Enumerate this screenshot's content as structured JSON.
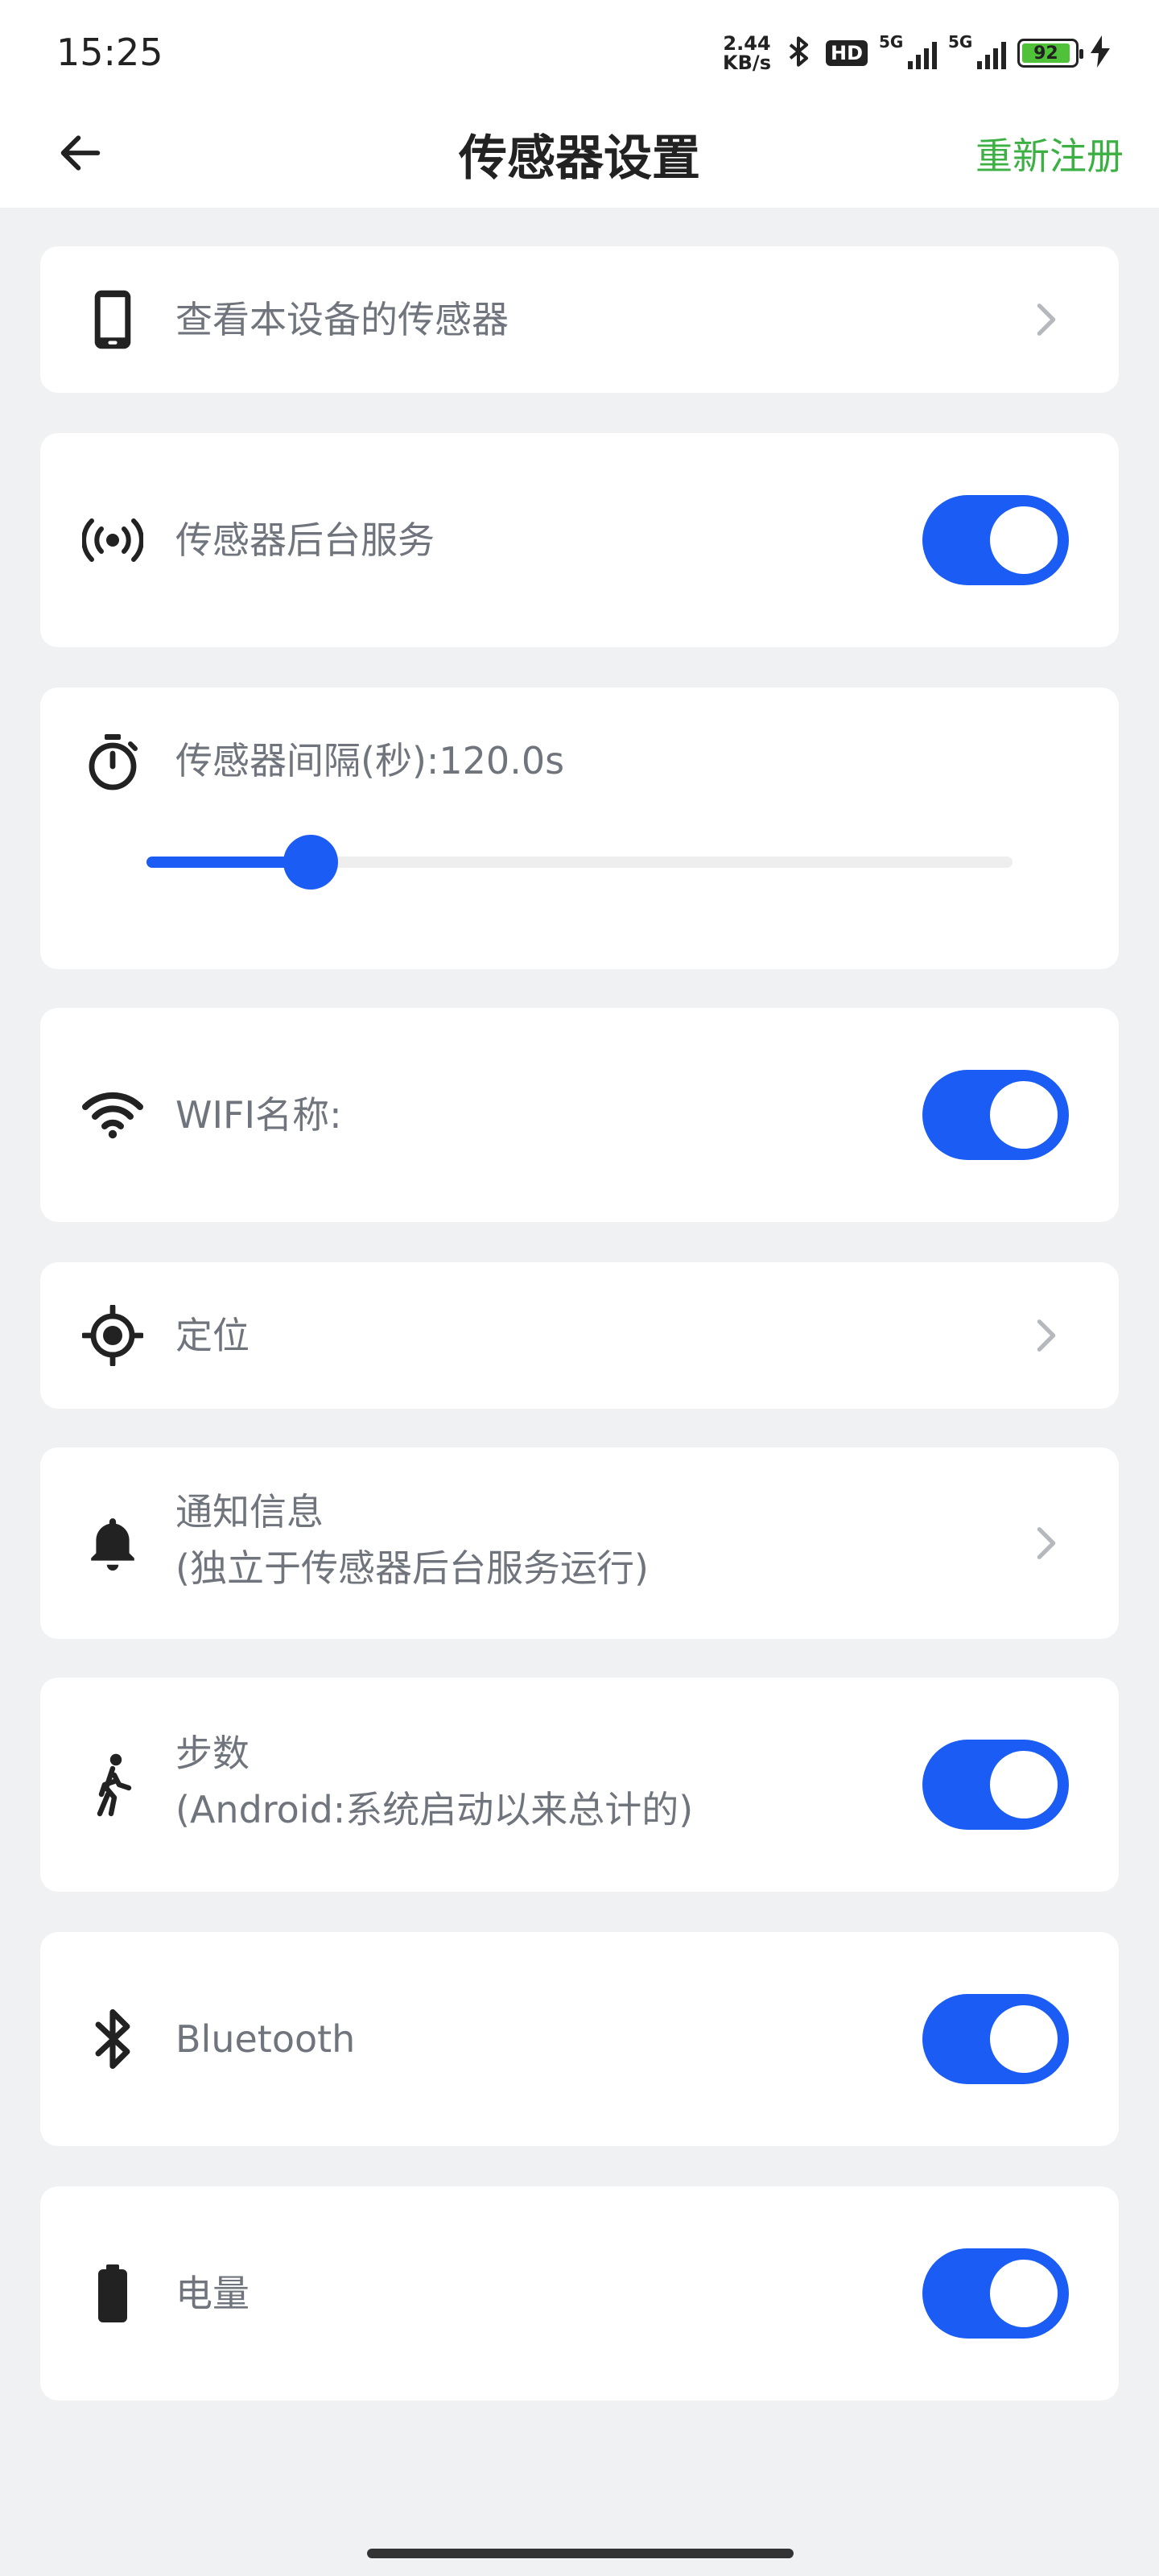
{
  "status_bar": {
    "time": "15:25",
    "net_speed_value": "2.44",
    "net_speed_unit": "KB/s",
    "hd_badge": "HD",
    "signal1_label": "5G",
    "signal2_label": "5G",
    "battery_level": "92",
    "icons": [
      "bluetooth-icon",
      "signal-icon",
      "battery-icon",
      "charging-icon"
    ]
  },
  "header": {
    "title": "传感器设置",
    "action_label": "重新注册",
    "back_icon": "arrow-left-icon"
  },
  "rows": {
    "view_sensors": {
      "label": "查看本设备的传感器",
      "icon": "phone-icon"
    },
    "background_service": {
      "label": "传感器后台服务",
      "icon": "broadcast-icon",
      "enabled": true
    },
    "interval": {
      "label": "传感器间隔(秒):120.0s",
      "icon": "timer-icon",
      "value_fraction": 0.19
    },
    "wifi": {
      "label": "WIFI名称:",
      "icon": "wifi-icon",
      "enabled": true
    },
    "location": {
      "label": "定位",
      "icon": "location-target-icon"
    },
    "notification": {
      "label_line1": "通知信息",
      "label_line2": "(独立于传感器后台服务运行)",
      "icon": "bell-icon"
    },
    "steps": {
      "label_line1": "步数",
      "label_line2": "(Android:系统启动以来总计的)",
      "icon": "walk-icon",
      "enabled": true
    },
    "bluetooth": {
      "label": "Bluetooth",
      "icon": "bluetooth-icon",
      "enabled": true
    },
    "battery": {
      "label": "电量",
      "icon": "battery-icon",
      "enabled": true
    }
  },
  "colors": {
    "accent": "#1b5cf5",
    "action_green": "#3cb043",
    "label_gray": "#70757d",
    "background": "#f0f1f3"
  }
}
